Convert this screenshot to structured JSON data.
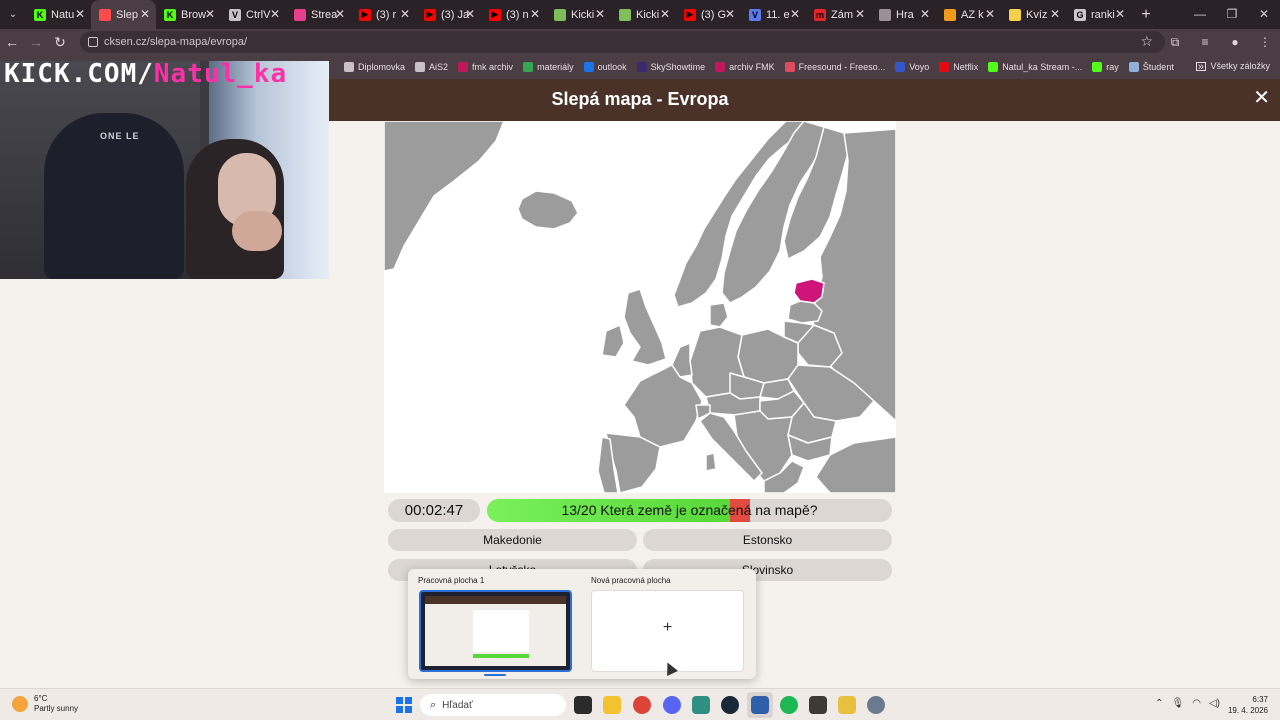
{
  "browser": {
    "tabs": [
      {
        "label": "Natu",
        "favicon_color": "#53fc18",
        "favicon_text": "K"
      },
      {
        "label": "Slep",
        "favicon_color": "#ff4b4b",
        "favicon_text": ""
      },
      {
        "label": "Brow",
        "favicon_color": "#53fc18",
        "favicon_text": "K"
      },
      {
        "label": "CtrlV",
        "favicon_color": "#c9c1c5",
        "favicon_text": "V"
      },
      {
        "label": "Strea",
        "favicon_color": "#e83e8c",
        "favicon_text": ""
      },
      {
        "label": "(3) r",
        "favicon_color": "#ff0000",
        "favicon_text": "▶"
      },
      {
        "label": "(3) Ja",
        "favicon_color": "#ff0000",
        "favicon_text": "▶"
      },
      {
        "label": "(3) n",
        "favicon_color": "#ff0000",
        "favicon_text": "▶"
      },
      {
        "label": "Kicki",
        "favicon_color": "#7fbf5a",
        "favicon_text": ""
      },
      {
        "label": "Kicki",
        "favicon_color": "#7fbf5a",
        "favicon_text": ""
      },
      {
        "label": "(3) G",
        "favicon_color": "#ff0000",
        "favicon_text": "▶"
      },
      {
        "label": "11. e",
        "favicon_color": "#5b7cf0",
        "favicon_text": "V"
      },
      {
        "label": "Zám",
        "favicon_color": "#e4232b",
        "favicon_text": "m"
      },
      {
        "label": "Hra",
        "favicon_color": "#9a9096",
        "favicon_text": ""
      },
      {
        "label": "AZ k",
        "favicon_color": "#f39a1e",
        "favicon_text": ""
      },
      {
        "label": "Kvíz",
        "favicon_color": "#f5d04a",
        "favicon_text": ""
      },
      {
        "label": "ranki",
        "favicon_color": "#cfc6cb",
        "favicon_text": "G"
      }
    ],
    "active_tab_index": 1,
    "url": "cksen.cz/slepa-mapa/evropa/",
    "bookmarks": [
      {
        "label": "Diplomovka",
        "color": "#c9c1c5"
      },
      {
        "label": "AiS2",
        "color": "#c9c1c5"
      },
      {
        "label": "fmk archiv",
        "color": "#c2185b"
      },
      {
        "label": "materiály",
        "color": "#34a853"
      },
      {
        "label": "outlook",
        "color": "#1a73e8"
      },
      {
        "label": "SkyShowtime",
        "color": "#3b2a6b"
      },
      {
        "label": "archiv FMK",
        "color": "#c2185b"
      },
      {
        "label": "Freesound - Freeso...",
        "color": "#e04a5f"
      },
      {
        "label": "Voyo",
        "color": "#3357c7"
      },
      {
        "label": "Netflix",
        "color": "#e50914"
      },
      {
        "label": "Natul_ka Stream -...",
        "color": "#53fc18"
      },
      {
        "label": "ray",
        "color": "#53fc18"
      },
      {
        "label": "Študent",
        "color": "#8fb0d8"
      }
    ],
    "all_bookmarks_label": "Všetky záložky"
  },
  "webcam": {
    "banner_part1": "KICK.COM/",
    "banner_part2": "Natul_ka",
    "chair_logo": "ONE LE"
  },
  "page": {
    "title": "Slepá mapa - Evropa",
    "timer": "00:02:47",
    "question": "13/20 Která země je označená na mapě?",
    "answers": [
      "Makedonie",
      "Estonsko",
      "Lotyšsko",
      "Slovinsko"
    ],
    "highlight_color": "#d0157a",
    "progress_correct": 13,
    "progress_total": 20
  },
  "taskview": {
    "desktop1_label": "Pracovná plocha 1",
    "desktop2_label": "Nová pracovná plocha",
    "add_symbol": "+"
  },
  "taskbar": {
    "weather_temp": "6°C",
    "weather_desc": "Partly sunny",
    "search_placeholder": "Hľadať",
    "time": "6:37",
    "date": "19. 4. 2026"
  }
}
